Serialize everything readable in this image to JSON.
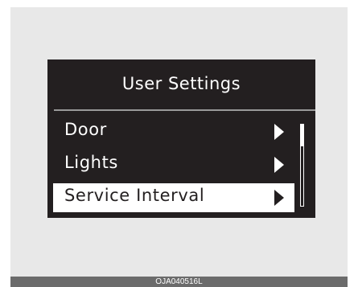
{
  "screen": {
    "title": "User Settings",
    "items": [
      {
        "label": "Door",
        "selected": false,
        "icon": "chevron-right-icon"
      },
      {
        "label": "Lights",
        "selected": false,
        "icon": "chevron-right-icon"
      },
      {
        "label": "Service Interval",
        "selected": true,
        "icon": "chevron-right-icon"
      }
    ],
    "colors": {
      "background": "#231f20",
      "foreground": "#ffffff",
      "highlight": "#ffffff"
    }
  },
  "caption": "OJA040516L"
}
